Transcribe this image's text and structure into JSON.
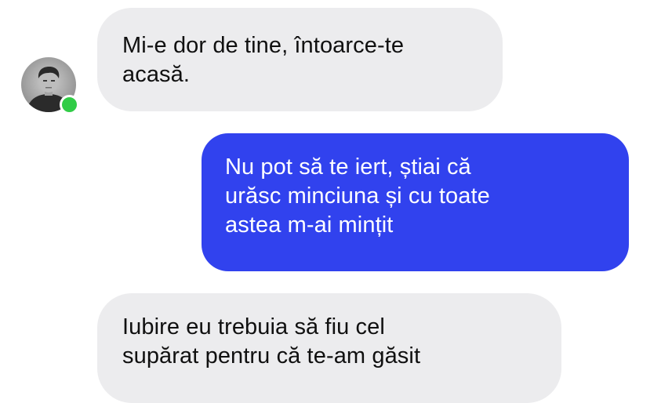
{
  "conversation": {
    "messages": [
      {
        "direction": "incoming",
        "lines": [
          "Mi-e dor de tine, întoarce-te",
          "acasă."
        ]
      },
      {
        "direction": "outgoing",
        "lines": [
          "Nu pot să te iert, știai că",
          "urăsc minciuna și cu toate",
          "astea m-ai mințit"
        ]
      },
      {
        "direction": "incoming",
        "lines": [
          "Iubire eu trebuia să fiu cel",
          "supărat pentru că te-am găsit"
        ]
      }
    ],
    "contact": {
      "online": true,
      "avatar_icon": "person-photo-icon",
      "presence_icon": "online-dot-icon"
    }
  },
  "colors": {
    "incoming_bubble": "#ececee",
    "outgoing_bubble": "#3142ee",
    "online_status": "#31cc47"
  }
}
